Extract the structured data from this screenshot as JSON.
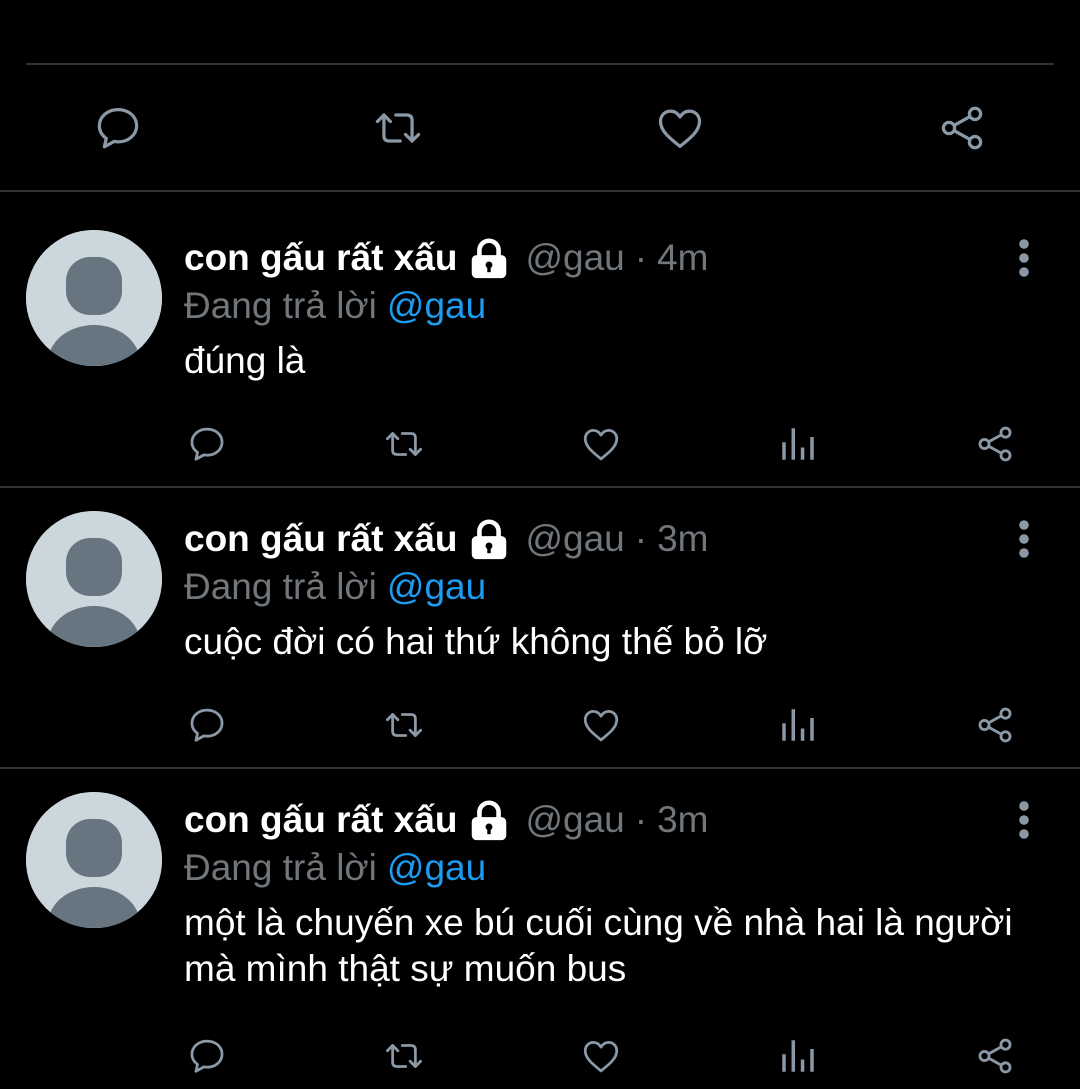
{
  "top_action_bar": {
    "icons": [
      "reply-icon",
      "retweet-icon",
      "like-icon",
      "share-icon"
    ]
  },
  "colors": {
    "background": "#000000",
    "text_primary": "#ffffff",
    "text_secondary": "#71767b",
    "link": "#1d9bf0",
    "divider": "#2f3336",
    "icon": "#8b98a5"
  },
  "tweets": [
    {
      "display_name": "con gấu rất xấu",
      "handle": "@gau",
      "separator": "·",
      "time": "4m",
      "replying_prefix": "Đang trả lời",
      "replying_to": "@gau",
      "text": "đúng là"
    },
    {
      "display_name": "con gấu rất xấu",
      "handle": "@gau",
      "separator": "·",
      "time": "3m",
      "replying_prefix": "Đang trả lời",
      "replying_to": "@gau",
      "text": "cuộc đời có hai thứ không thế bỏ lỡ"
    },
    {
      "display_name": "con gấu rất xấu",
      "handle": "@gau",
      "separator": "·",
      "time": "3m",
      "replying_prefix": "Đang trả lời",
      "replying_to": "@gau",
      "text": "một là chuyến xe bú cuối cùng về nhà hai là người mà mình thật sự muốn bus"
    }
  ]
}
